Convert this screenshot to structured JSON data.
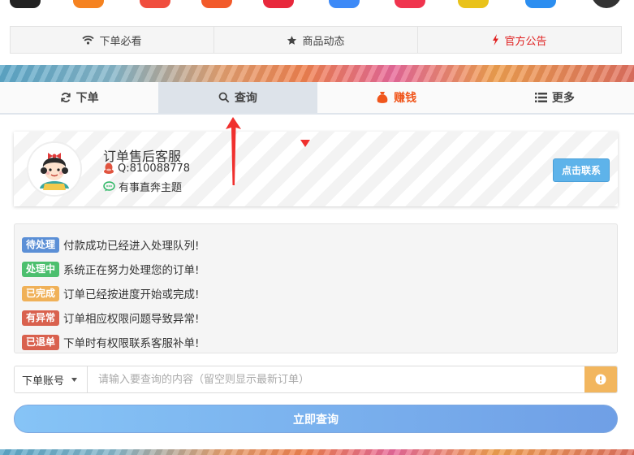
{
  "app_icons": [
    {
      "name": "app-icon-1",
      "color": "#222222"
    },
    {
      "name": "app-icon-2",
      "color": "#f58220"
    },
    {
      "name": "app-icon-3",
      "color": "#f04e3e"
    },
    {
      "name": "app-icon-4",
      "color": "#f25a2a"
    },
    {
      "name": "app-icon-5",
      "color": "#e8283c"
    },
    {
      "name": "app-icon-6",
      "color": "#3d8af7"
    },
    {
      "name": "app-icon-7",
      "color": "#f0344e"
    },
    {
      "name": "app-icon-8",
      "color": "#e9c21a"
    },
    {
      "name": "app-icon-9",
      "color": "#2c8ef0"
    },
    {
      "name": "app-icon-10",
      "color": "#333333"
    }
  ],
  "notice_tabs": {
    "must_read": "下单必看",
    "product_news": "商品动态",
    "announcement": "官方公告"
  },
  "nav": {
    "order": "下单",
    "query": "查询",
    "earn": "赚钱",
    "more": "更多"
  },
  "service": {
    "title": "订单售后客服",
    "qq": "Q:810088778",
    "slogan": "有事直奔主题",
    "contact_label": "点击联系"
  },
  "status_legend": [
    {
      "badge": "待处理",
      "text": "付款成功已经进入处理队列!",
      "color": "#5b8fd6"
    },
    {
      "badge": "处理中",
      "text": "系统正在努力处理您的订单!",
      "color": "#4cbf6e"
    },
    {
      "badge": "已完成",
      "text": "订单已经按进度开始或完成!",
      "color": "#f0b158"
    },
    {
      "badge": "有异常",
      "text": "订单相应权限问题导致异常!",
      "color": "#d9614e"
    },
    {
      "badge": "已退单",
      "text": "下单时有权限联系客服补单!",
      "color": "#d9614e"
    }
  ],
  "query": {
    "account_type": "下单账号",
    "placeholder": "请输入要查询的内容（留空则显示最新订单）",
    "submit_label": "立即查询"
  }
}
